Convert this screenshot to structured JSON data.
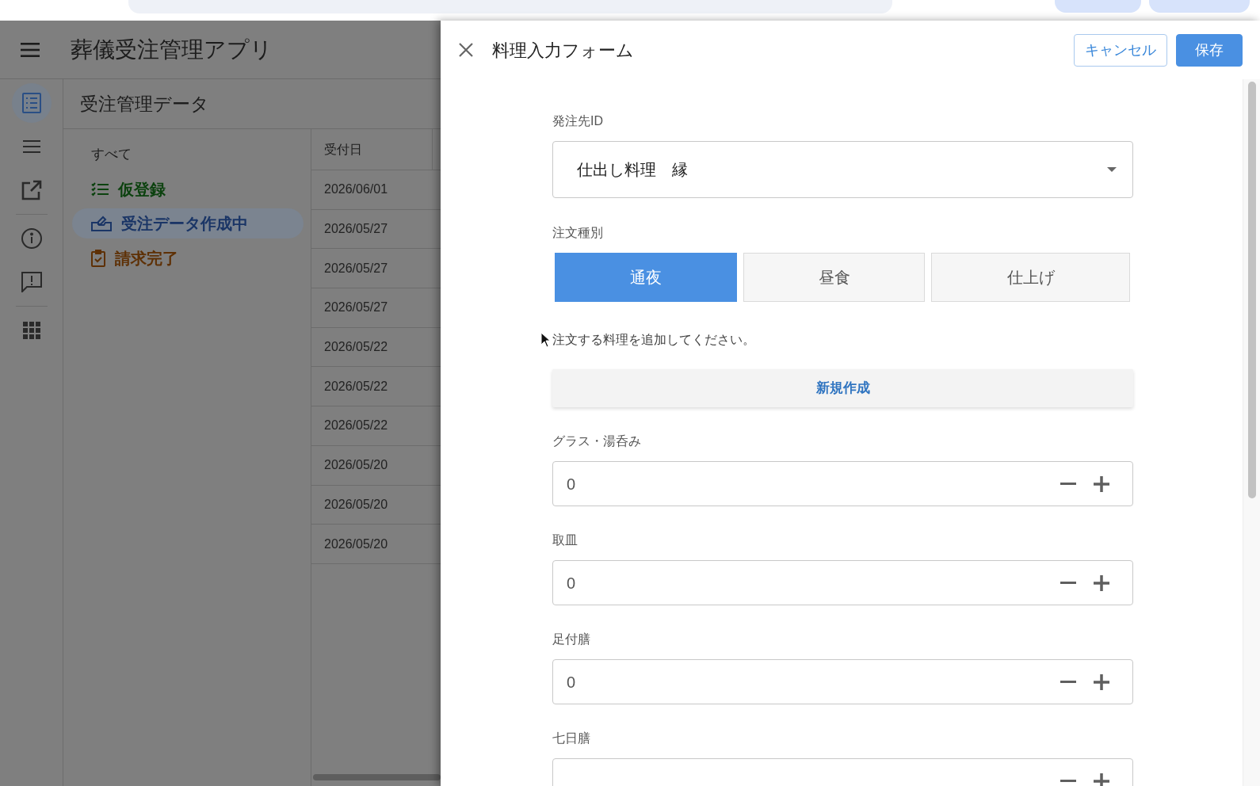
{
  "app": {
    "title": "葬儀受注管理アプリ"
  },
  "nav_rail": {
    "groups": [
      [
        {
          "selected": true
        },
        {
          "selected": false
        },
        {
          "selected": false
        }
      ],
      [
        {
          "selected": false
        },
        {
          "selected": false
        }
      ],
      [
        {
          "selected": false
        }
      ]
    ]
  },
  "view": {
    "title": "受注管理データ"
  },
  "filters": [
    {
      "label": "すべて",
      "selected": false
    },
    {
      "label": "仮登録",
      "selected": false,
      "color": "#0c420f"
    },
    {
      "label": "受注データ作成中",
      "selected": true,
      "color": "#1a3566"
    },
    {
      "label": "請求完了",
      "selected": false,
      "color": "#5e3005"
    }
  ],
  "table": {
    "columns": [
      "受付日"
    ],
    "rows": [
      [
        "2026/06/01"
      ],
      [
        "2026/05/27"
      ],
      [
        "2026/05/27"
      ],
      [
        "2026/05/27"
      ],
      [
        "2026/05/22"
      ],
      [
        "2026/05/22"
      ],
      [
        "2026/05/22"
      ],
      [
        "2026/05/20"
      ],
      [
        "2026/05/20"
      ],
      [
        "2026/05/20"
      ]
    ]
  },
  "form": {
    "title": "料理入力フォーム",
    "buttons": [
      {
        "label": "キャンセル",
        "kind": "secondary"
      },
      {
        "label": "保存",
        "kind": "primary"
      }
    ],
    "fields": [
      {
        "kind": "select",
        "label": "発注先ID",
        "value": "仕出し料理　縁"
      },
      {
        "kind": "segmented",
        "label": "注文種別",
        "options": [
          {
            "label": "通夜",
            "selected": true
          },
          {
            "label": "昼食",
            "selected": false
          },
          {
            "label": "仕上げ",
            "selected": false
          }
        ]
      },
      {
        "kind": "note",
        "text": "注文する料理を追加してください。"
      },
      {
        "kind": "action",
        "label": "新規作成"
      },
      {
        "kind": "stepper",
        "label": "グラス・湯呑み",
        "value": "0"
      },
      {
        "kind": "stepper",
        "label": "取皿",
        "value": "0"
      },
      {
        "kind": "stepper",
        "label": "足付膳",
        "value": "0"
      },
      {
        "kind": "stepper",
        "label": "七日膳"
      }
    ]
  }
}
